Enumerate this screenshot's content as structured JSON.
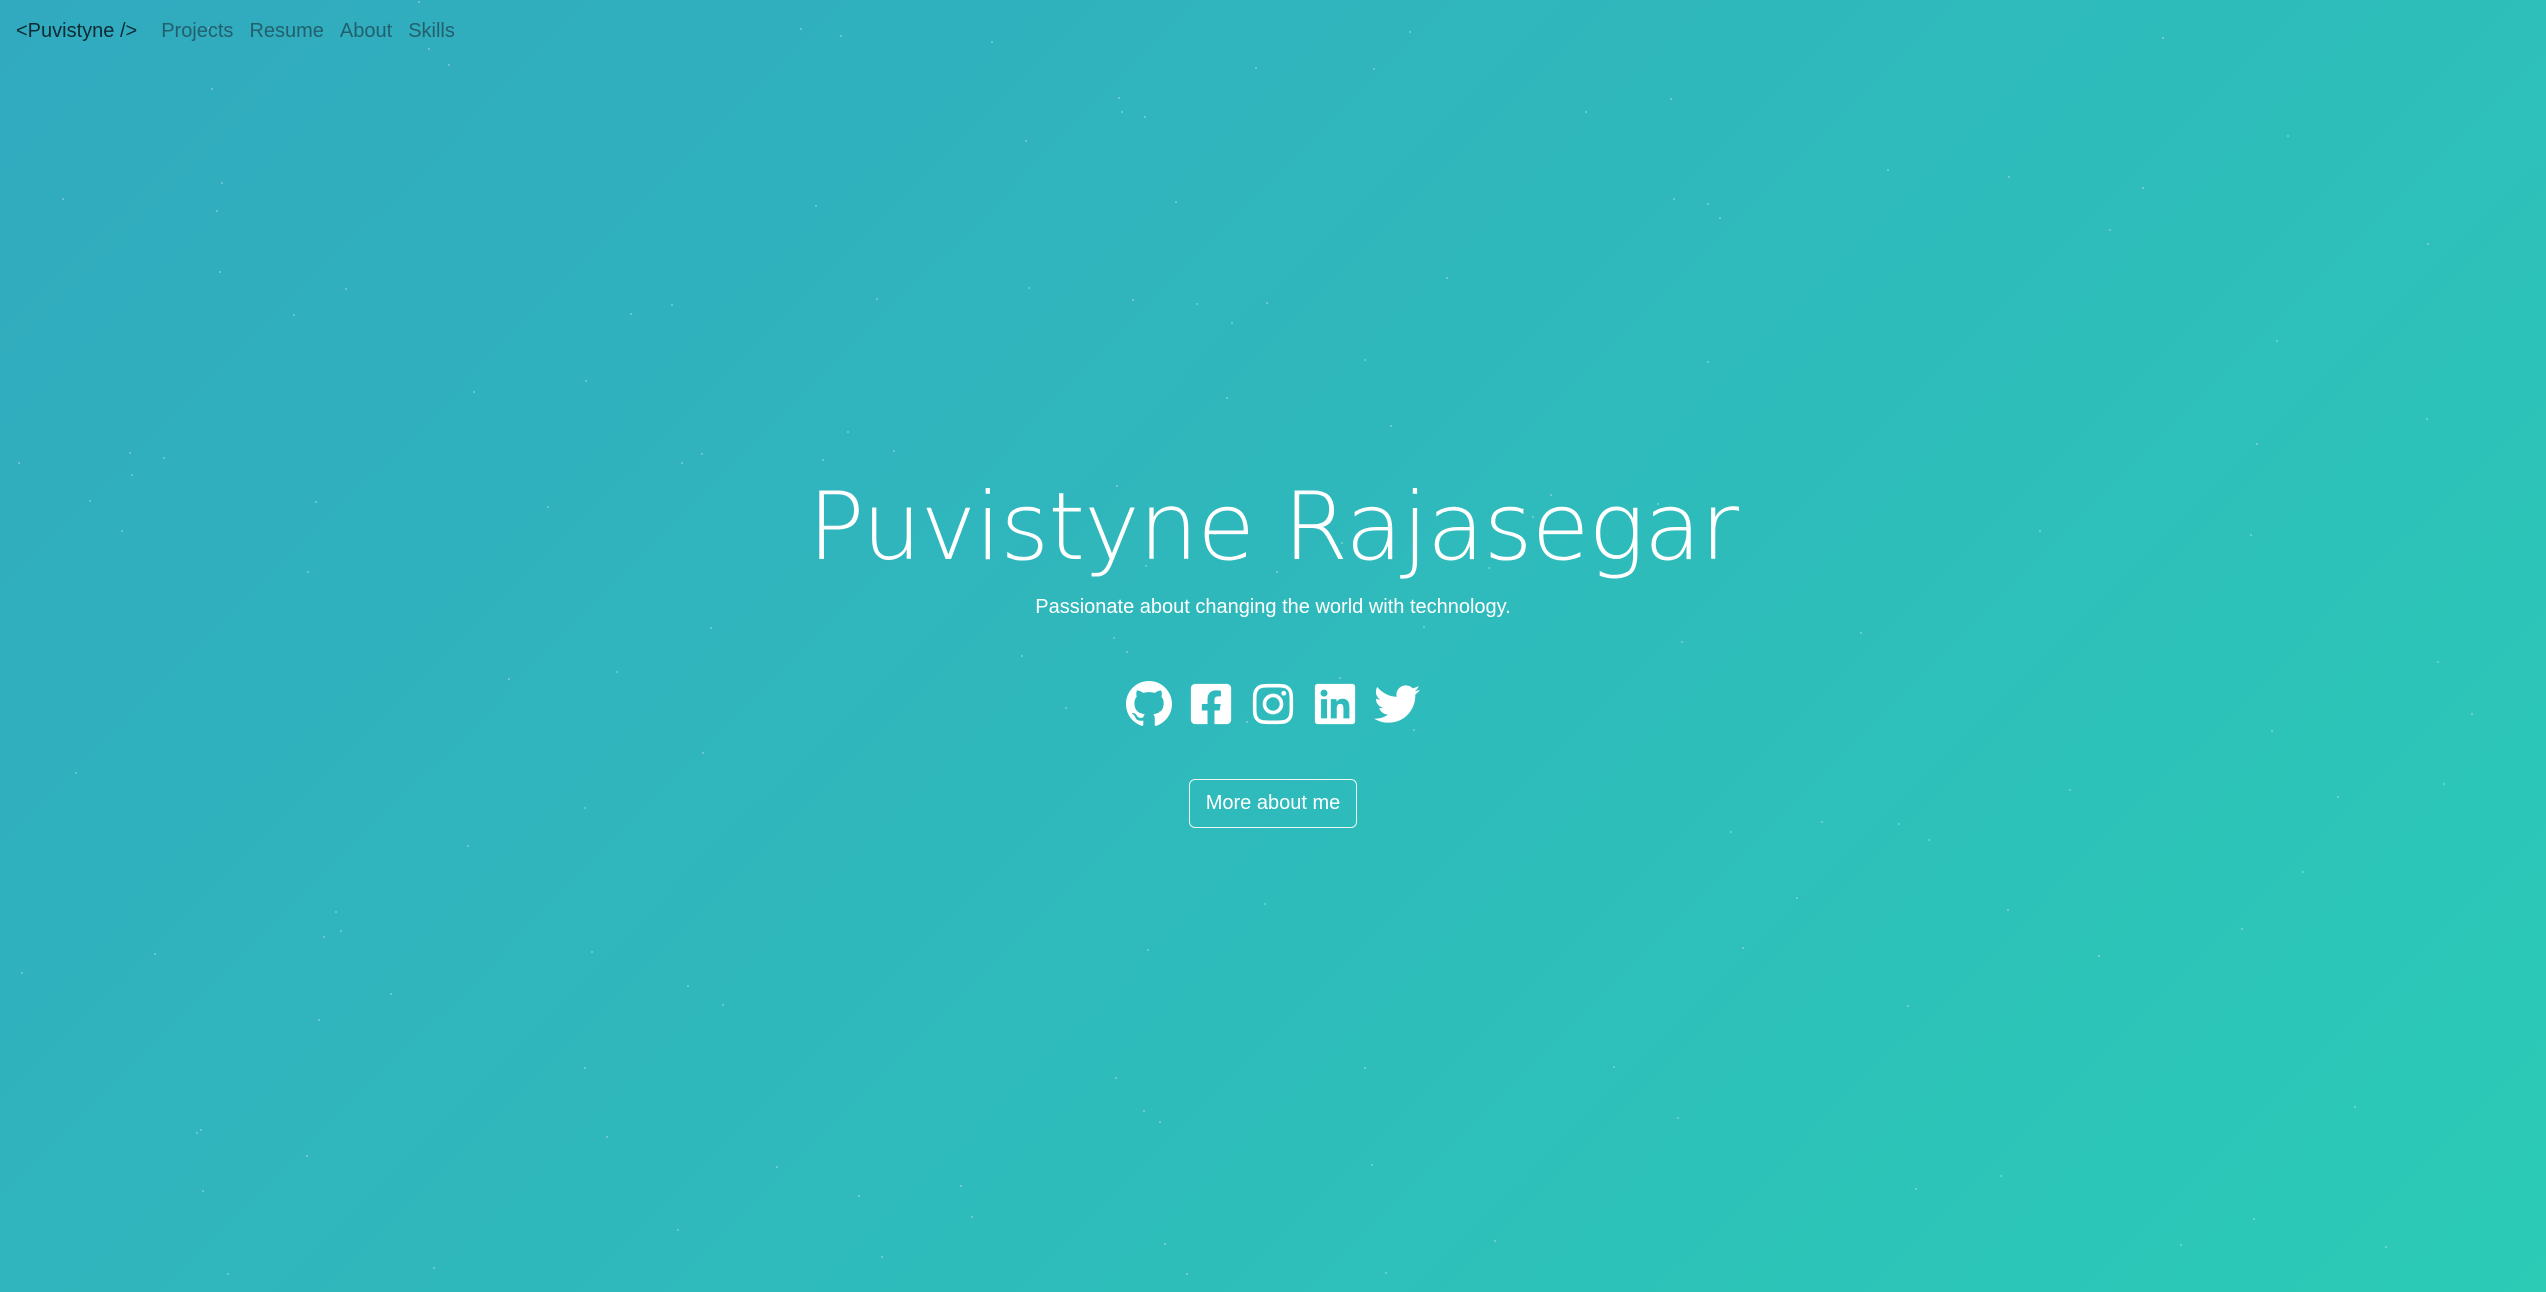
{
  "nav": {
    "brand": "<Puvistyne />",
    "links": [
      "Projects",
      "Resume",
      "About",
      "Skills"
    ]
  },
  "hero": {
    "title": "Puvistyne Rajasegar",
    "subtitle": "Passionate about changing the world with technology.",
    "socials": [
      "github-icon",
      "facebook-icon",
      "instagram-icon",
      "linkedin-icon",
      "twitter-icon"
    ],
    "cta_label": "More about me"
  },
  "colors": {
    "gradient_start": "#31aabf",
    "gradient_end": "#2bcbb6",
    "brand_text": "#0e2a33",
    "nav_link_text": "#22606d",
    "hero_text": "#ffffff"
  }
}
